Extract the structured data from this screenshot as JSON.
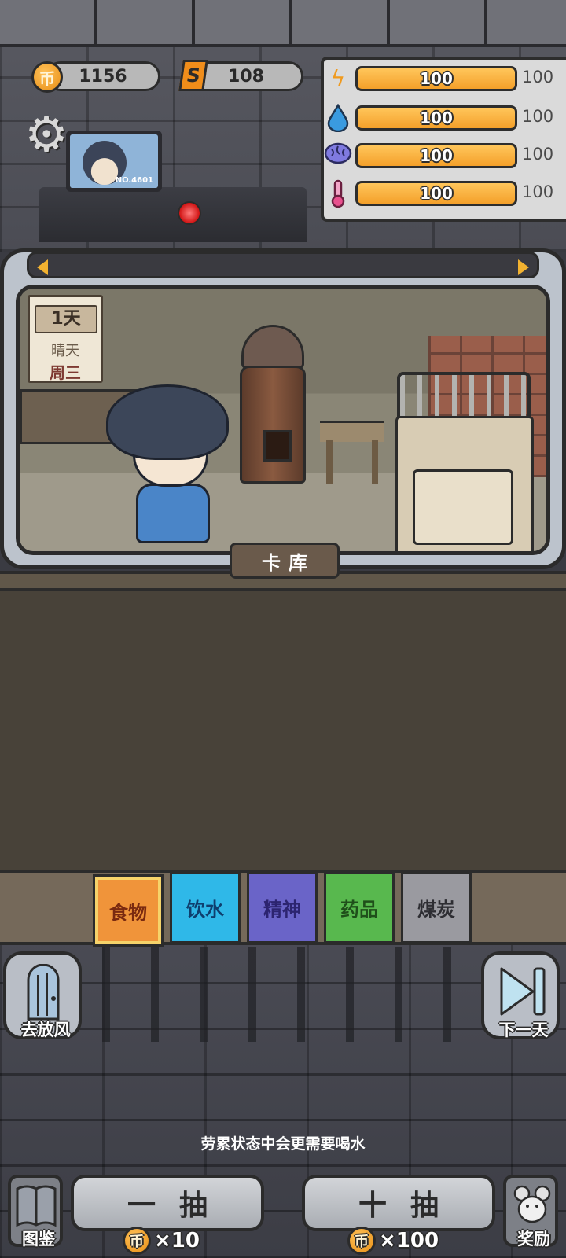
{
  "currency": {
    "coins": "1156",
    "coin_symbol": "币",
    "tokens": "108",
    "token_symbol": "S"
  },
  "stats": [
    {
      "icon": "energy-bolt-icon",
      "value": "100",
      "max": "100",
      "level": 1.0
    },
    {
      "icon": "water-drop-icon",
      "value": "100",
      "max": "100",
      "level": 1.0
    },
    {
      "icon": "brain-icon",
      "value": "100",
      "max": "100",
      "level": 1.0
    },
    {
      "icon": "thermometer-icon",
      "value": "100",
      "max": "100",
      "level": 1.0
    }
  ],
  "monitor": {
    "prisoner_no": "NO.4601"
  },
  "calendar": {
    "day": "1天",
    "weather": "晴天",
    "weekday": "周三"
  },
  "scene": {
    "label": "卡库"
  },
  "categories": [
    {
      "label": "食物",
      "bg": "#f0943a",
      "fg": "#7a2a10",
      "selected": true
    },
    {
      "label": "饮水",
      "bg": "#2fb8e8",
      "fg": "#0f3f6e",
      "selected": false
    },
    {
      "label": "精神",
      "bg": "#6a64c8",
      "fg": "#2c2470",
      "selected": false
    },
    {
      "label": "药品",
      "bg": "#58b84e",
      "fg": "#1f4f1a",
      "selected": false
    },
    {
      "label": "煤炭",
      "bg": "#9a9aa0",
      "fg": "#2e2e33",
      "selected": false
    }
  ],
  "buttons": {
    "go_out": "去放风",
    "next_day": "下一天",
    "catalog": "图鉴",
    "rewards": "奖励",
    "draw_one": "一抽",
    "draw_ten": "十抽"
  },
  "costs": {
    "one": "×10",
    "ten": "×100"
  },
  "tip": "劳累状态中会更需要喝水"
}
